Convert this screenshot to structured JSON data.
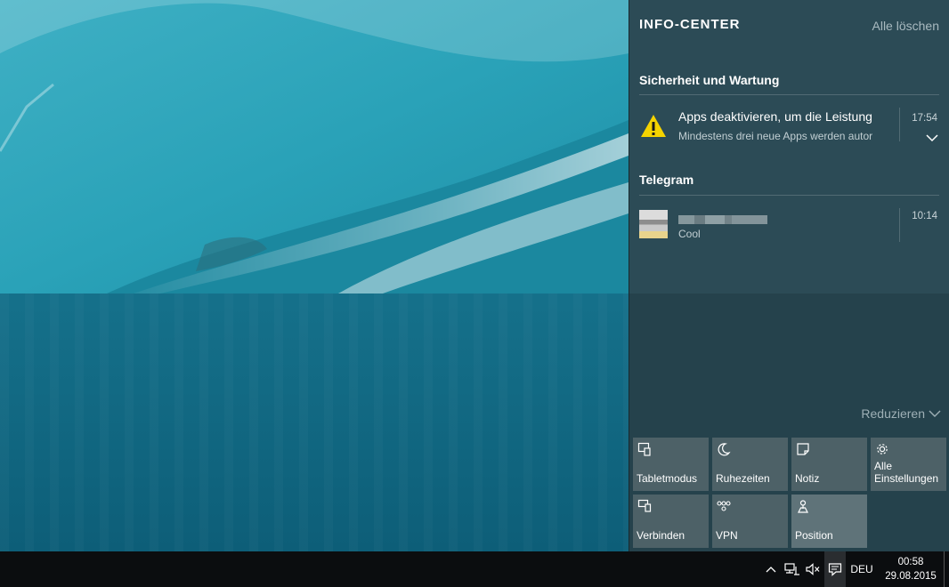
{
  "action_center": {
    "title": "INFO-CENTER",
    "clear_all": "Alle löschen",
    "groups": [
      {
        "name": "Sicherheit und Wartung",
        "notifications": [
          {
            "title": "Apps deaktivieren, um die Leistung",
            "body": "Mindestens drei neue Apps werden autor",
            "time": "17:54",
            "icon": "warning-icon"
          }
        ]
      },
      {
        "name": "Telegram",
        "notifications": [
          {
            "title": "",
            "body": "Cool",
            "time": "10:14",
            "icon": "avatar"
          }
        ]
      }
    ],
    "collapse_label": "Reduzieren",
    "quick_actions": [
      {
        "label": "Tabletmodus",
        "icon": "tablet-mode-icon",
        "active": false
      },
      {
        "label": "Ruhezeiten",
        "icon": "moon-icon",
        "active": false
      },
      {
        "label": "Notiz",
        "icon": "note-icon",
        "active": false
      },
      {
        "label": "Alle Einstellungen",
        "icon": "gear-icon",
        "active": false
      },
      {
        "label": "Verbinden",
        "icon": "connect-icon",
        "active": false
      },
      {
        "label": "VPN",
        "icon": "vpn-icon",
        "active": false
      },
      {
        "label": "Position",
        "icon": "location-icon",
        "active": true
      }
    ]
  },
  "taskbar": {
    "language": "DEU",
    "time": "00:58",
    "date": "29.08.2015",
    "tray_icons": [
      "chevron-up-icon",
      "network-icon",
      "volume-muted-icon",
      "action-center-icon"
    ]
  },
  "colors": {
    "accent_warning": "#f5d300",
    "panel": "#25424c",
    "tile": "#4d6167",
    "tile_active": "#5f7379"
  }
}
